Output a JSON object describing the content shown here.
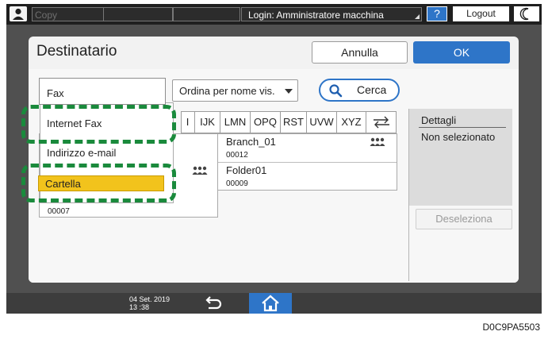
{
  "topbar": {
    "user_icon": "user-icon",
    "copy_label": "Copy",
    "login_label": "Login: Amministratore macchina",
    "help_label": "?",
    "logout_label": "Logout",
    "moon_icon": "moon-icon"
  },
  "dialog": {
    "title": "Destinatario",
    "cancel_label": "Annulla",
    "ok_label": "OK"
  },
  "toolbar": {
    "type_value": "Fax",
    "sort_value": "Ordina per nome vis.",
    "search_label": "Cerca",
    "search_icon": "search-icon"
  },
  "type_menu": {
    "items": [
      "Internet Fax",
      "Indirizzo e-mail",
      "Cartella"
    ],
    "selected": "Cartella",
    "partial_number": "00007"
  },
  "index_tabs": [
    "IJK",
    "LMN",
    "OPQ",
    "RST",
    "UVW",
    "XYZ"
  ],
  "index_partial": "I",
  "switch_icon": "switch-view-icon",
  "entries": [
    {
      "name": "Branch_01",
      "number": "00012",
      "icon": "group-icon"
    },
    {
      "name": "Folder01",
      "number": "00009",
      "icon": "group-icon"
    }
  ],
  "left_row_icon": "group-icon",
  "details": {
    "header": "Dettagli",
    "value": "Non selezionato",
    "deselect_label": "Deseleziona"
  },
  "bottombar": {
    "date": "04 Set. 2019",
    "time": "13 :38",
    "back_icon": "back-arrow-icon",
    "home_icon": "home-icon"
  },
  "caption": "D0C9PA5503",
  "colors": {
    "accent_blue": "#2e75c8",
    "selected_yellow": "#f2c31c",
    "highlight_green": "#1a8a3c",
    "status_bar": "#1f1f1f"
  }
}
